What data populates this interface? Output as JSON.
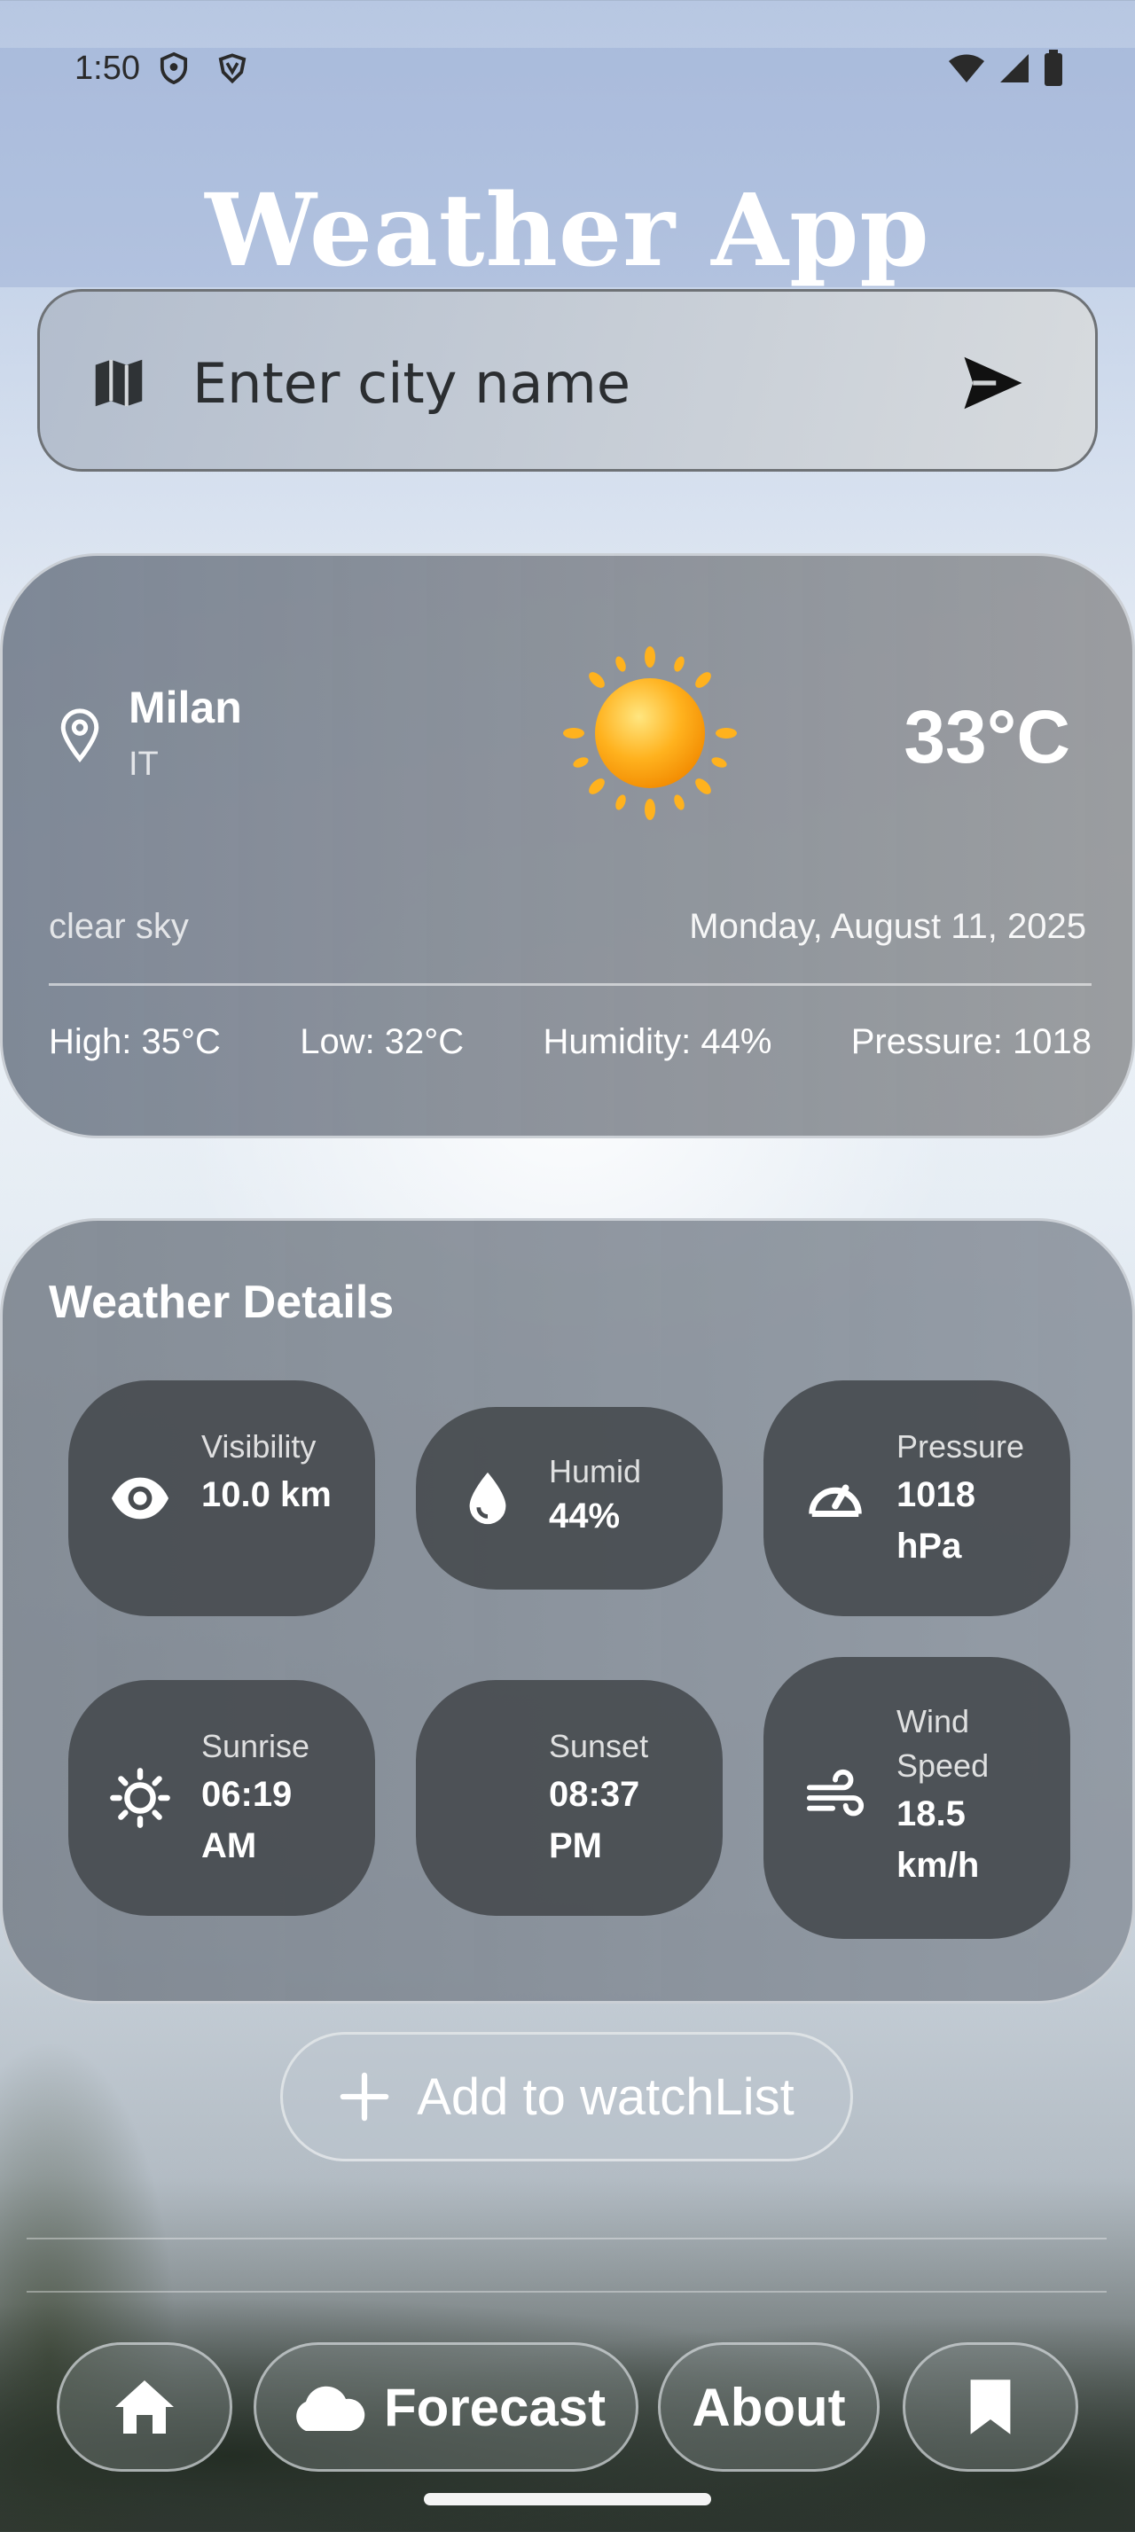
{
  "status_bar": {
    "time": "1:50",
    "left_icons": [
      "shield-icon",
      "vpn-shield-icon"
    ],
    "right_icons": [
      "wifi-icon",
      "signal-icon",
      "battery-icon"
    ]
  },
  "header": {
    "title": "Weather App"
  },
  "search": {
    "placeholder": "Enter city name",
    "value": ""
  },
  "current": {
    "city": "Milan",
    "country": "IT",
    "temperature": "33°C",
    "condition": "clear sky",
    "date": "Monday, August 11, 2025",
    "high": "High: 35°C",
    "low": "Low: 32°C",
    "humidity": "Humidity: 44%",
    "pressure": "Pressure: 1018"
  },
  "details": {
    "title": "Weather Details",
    "tiles": [
      {
        "label": "Visibility",
        "value": "10.0 km",
        "icon": "eye-icon"
      },
      {
        "label": "Humid",
        "value": "44%",
        "icon": "water-drop-icon"
      },
      {
        "label": "Pressure",
        "value": "1018 hPa",
        "icon": "speedometer-icon"
      },
      {
        "label": "Sunrise",
        "value": "06:19 AM",
        "icon": "sun-icon"
      },
      {
        "label": "Sunset",
        "value": "08:37 PM",
        "icon": "moon-icon"
      },
      {
        "label": "Wind Speed",
        "value": "18.5 km/h",
        "icon": "wind-icon"
      }
    ]
  },
  "watchlist_button": {
    "label": "Add to watchList"
  },
  "nav": {
    "forecast": "Forecast",
    "about": "About"
  },
  "colors": {
    "text_on_glass": "#ffffff",
    "tile_bg": "#484c50",
    "sun": "#ffb020"
  }
}
